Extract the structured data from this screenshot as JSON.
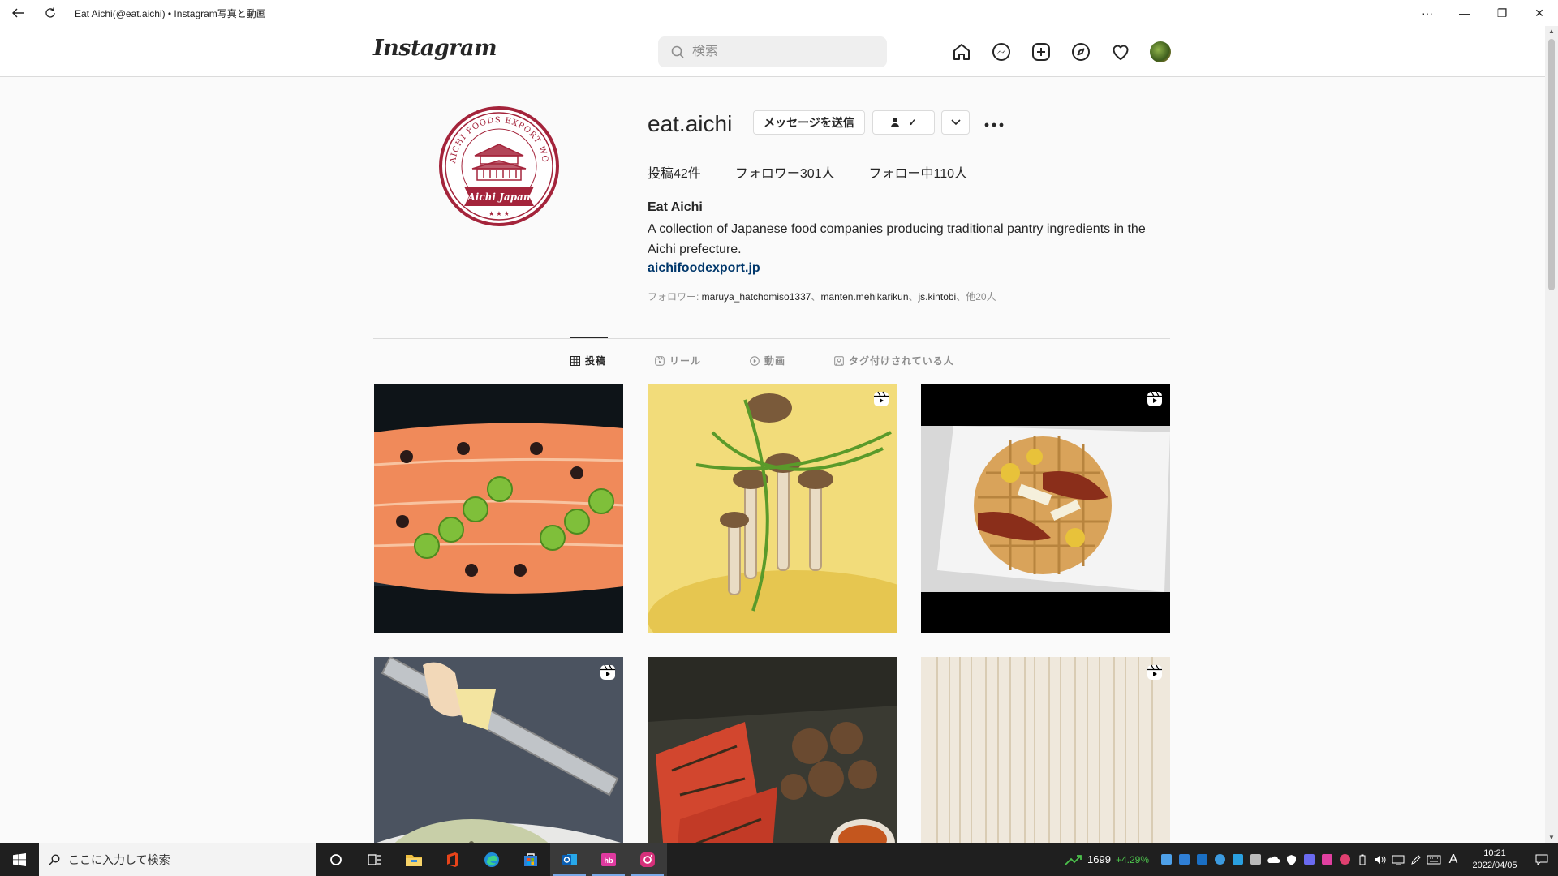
{
  "window": {
    "title": "Eat Aichi(@eat.aichi) • Instagram写真と動画",
    "controls": [
      "···",
      "—",
      "❐",
      "✕"
    ]
  },
  "header": {
    "logo": "Instagram",
    "search_placeholder": "検索",
    "nav_icons": [
      "home-icon",
      "messenger-icon",
      "new-post-icon",
      "explore-icon",
      "activity-heart-icon",
      "profile-avatar"
    ]
  },
  "profile": {
    "username": "eat.aichi",
    "message_button": "メッセージを送信",
    "follow_button_glyph": "✓",
    "dropdown_glyph": "⌄",
    "more_glyph": "•••",
    "stats": {
      "posts": "投稿42件",
      "followers": "フォロワー301人",
      "following": "フォロー中110人"
    },
    "full_name": "Eat Aichi",
    "bio": "A collection of Japanese food companies producing traditional pantry ingredients in the Aichi prefecture.",
    "link": "aichifoodexport.jp",
    "followed_by_prefix": "フォロワー: ",
    "followed_by_names": [
      "maruya_hatchomiso1337",
      "manten.mehikarikun",
      "js.kintobi"
    ],
    "followed_by_sep": "、",
    "followed_by_more": "他20人",
    "avatar_seal_text_top": "AICHI FOODS EXPORT WORK SHOP",
    "avatar_seal_text_bottom": "Aichi Japan"
  },
  "tabs": [
    {
      "label": "投稿",
      "icon": "grid-icon",
      "active": true
    },
    {
      "label": "リール",
      "icon": "reels-icon",
      "active": false
    },
    {
      "label": "動画",
      "icon": "video-icon",
      "active": false
    },
    {
      "label": "タグ付けされている人",
      "icon": "tagged-icon",
      "active": false
    }
  ],
  "posts": [
    {
      "subject": "salmon-with-jalapeno",
      "reel": false
    },
    {
      "subject": "mushrooms-on-polenta",
      "reel": true
    },
    {
      "subject": "waffle-with-toppings",
      "reel": true
    },
    {
      "subject": "grating-cheese-over-pasta",
      "reel": true
    },
    {
      "subject": "dried-bonito-and-shiitake",
      "reel": false
    },
    {
      "subject": "dried-noodles",
      "reel": true
    }
  ],
  "taskbar": {
    "search_placeholder": "ここに入力して検索",
    "apps": [
      "cortana-icon",
      "task-view-icon",
      "file-explorer-icon",
      "office-icon",
      "edge-icon",
      "store-icon",
      "outlook-icon",
      "hatena-icon",
      "instagram-icon"
    ],
    "stock_value": "1699",
    "stock_change": "+4.29%",
    "ime": "A",
    "time": "10:21",
    "date": "2022/04/05"
  },
  "colors": {
    "accent_link": "#00376b",
    "seal_red": "#a4243b",
    "stock_up": "#4cc24c"
  }
}
